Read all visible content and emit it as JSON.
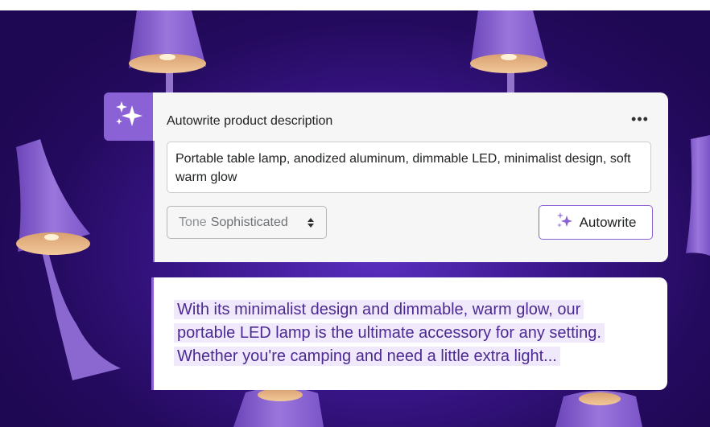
{
  "card": {
    "title": "Autowrite product description",
    "more_label": "•••",
    "input_value": "Portable table lamp, anodized aluminum, dimmable LED, minimalist design, soft warm glow",
    "tone_label": "Tone",
    "tone_value": "Sophisticated",
    "autowrite_label": "Autowrite"
  },
  "output": {
    "lines": [
      "With its minimalist design and dimmable, warm glow, our",
      "portable LED lamp is the ultimate accessory for any setting.",
      "Whether you're camping and need a little extra light..."
    ]
  },
  "colors": {
    "background": "#2a0d68",
    "accent": "#8a62d6",
    "output_text": "#4c2a91",
    "highlight": "#efe9fb"
  },
  "icons": {
    "badge": "sparkles-icon",
    "button": "sparkles-icon",
    "more": "more-horizontal-icon",
    "select": "chevron-updown-icon"
  }
}
